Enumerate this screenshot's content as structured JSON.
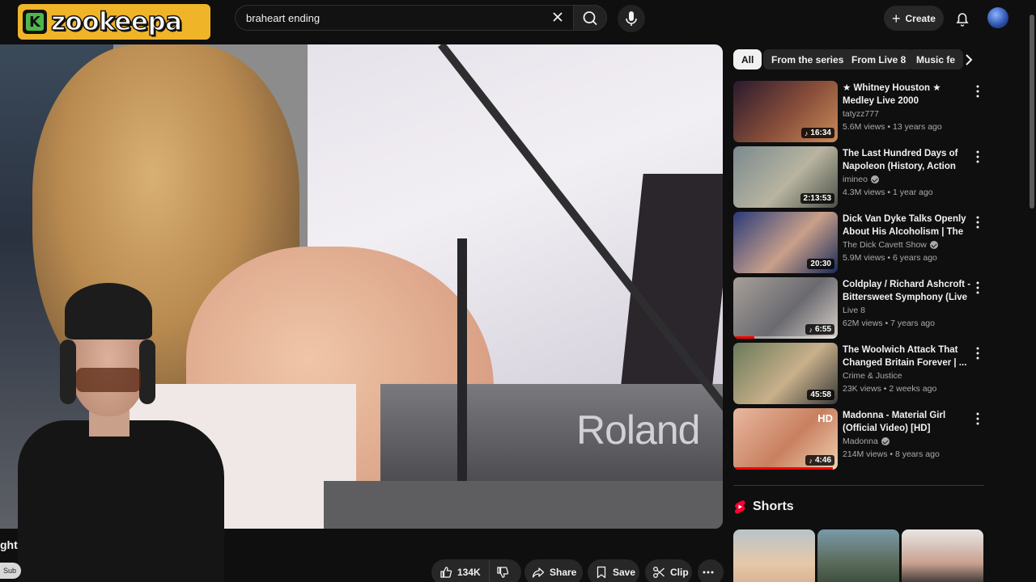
{
  "brand": {
    "logo_letter": "K",
    "logo_text": "zookeepa"
  },
  "search": {
    "query": "braheart ending"
  },
  "header": {
    "create_label": "Create"
  },
  "overlay": {
    "channel_text_fragment": "ght",
    "subscribe_fragment": "Sub"
  },
  "actions": {
    "likes": "134K",
    "share_label": "Share",
    "save_label": "Save",
    "clip_label": "Clip"
  },
  "video": {
    "keyboard_brand": "Roland"
  },
  "chips": [
    {
      "label": "All",
      "active": true
    },
    {
      "label": "From the series"
    },
    {
      "label": "From Live 8"
    },
    {
      "label": "Music fe"
    }
  ],
  "recommendations": [
    {
      "title": "★ Whitney Houston ★ Medley Live 2000",
      "channel": "tatyzz777",
      "verified": false,
      "meta": "5.6M views • 13 years ago",
      "duration": "16:34",
      "music": true,
      "thumb_colors": [
        "#2a1a2e",
        "#8a4f3a",
        "#c98a5a"
      ]
    },
    {
      "title": "The Last Hundred Days of Napoleon (History, Action film...",
      "channel": "imineo",
      "verified": true,
      "meta": "4.3M views • 1 year ago",
      "duration": "2:13:53",
      "music": false,
      "thumb_colors": [
        "#7a8a8e",
        "#b8b4a0",
        "#4a5048"
      ]
    },
    {
      "title": "Dick Van Dyke Talks Openly About His Alcoholism | The Di...",
      "channel": "The Dick Cavett Show",
      "verified": true,
      "meta": "5.9M views • 6 years ago",
      "duration": "20:30",
      "music": false,
      "thumb_colors": [
        "#2a3a7a",
        "#c9a08a",
        "#1a2a5a"
      ]
    },
    {
      "title": "Coldplay / Richard Ashcroft - Bittersweet Symphony (Live 8 ...",
      "channel": "Live 8",
      "verified": false,
      "meta": "62M views • 7 years ago",
      "duration": "6:55",
      "music": true,
      "thumb_colors": [
        "#a8a098",
        "#6a6a70",
        "#d8d0c8"
      ],
      "progress": 0.2
    },
    {
      "title": "The Woolwich Attack That Changed Britain Forever | ...",
      "channel": "Crime & Justice",
      "verified": false,
      "meta": "23K views • 2 weeks ago",
      "duration": "45:58",
      "music": false,
      "thumb_colors": [
        "#6a7a5a",
        "#c8b08a",
        "#3a3a3a"
      ]
    },
    {
      "title": "Madonna - Material Girl (Official Video) [HD]",
      "channel": "Madonna",
      "verified": true,
      "meta": "214M views • 8 years ago",
      "duration": "4:46",
      "music": true,
      "badge": "HD",
      "thumb_colors": [
        "#e8b8a0",
        "#c88060",
        "#f0d0b0"
      ],
      "progress": 0.95
    }
  ],
  "shorts": {
    "heading": "Shorts"
  }
}
